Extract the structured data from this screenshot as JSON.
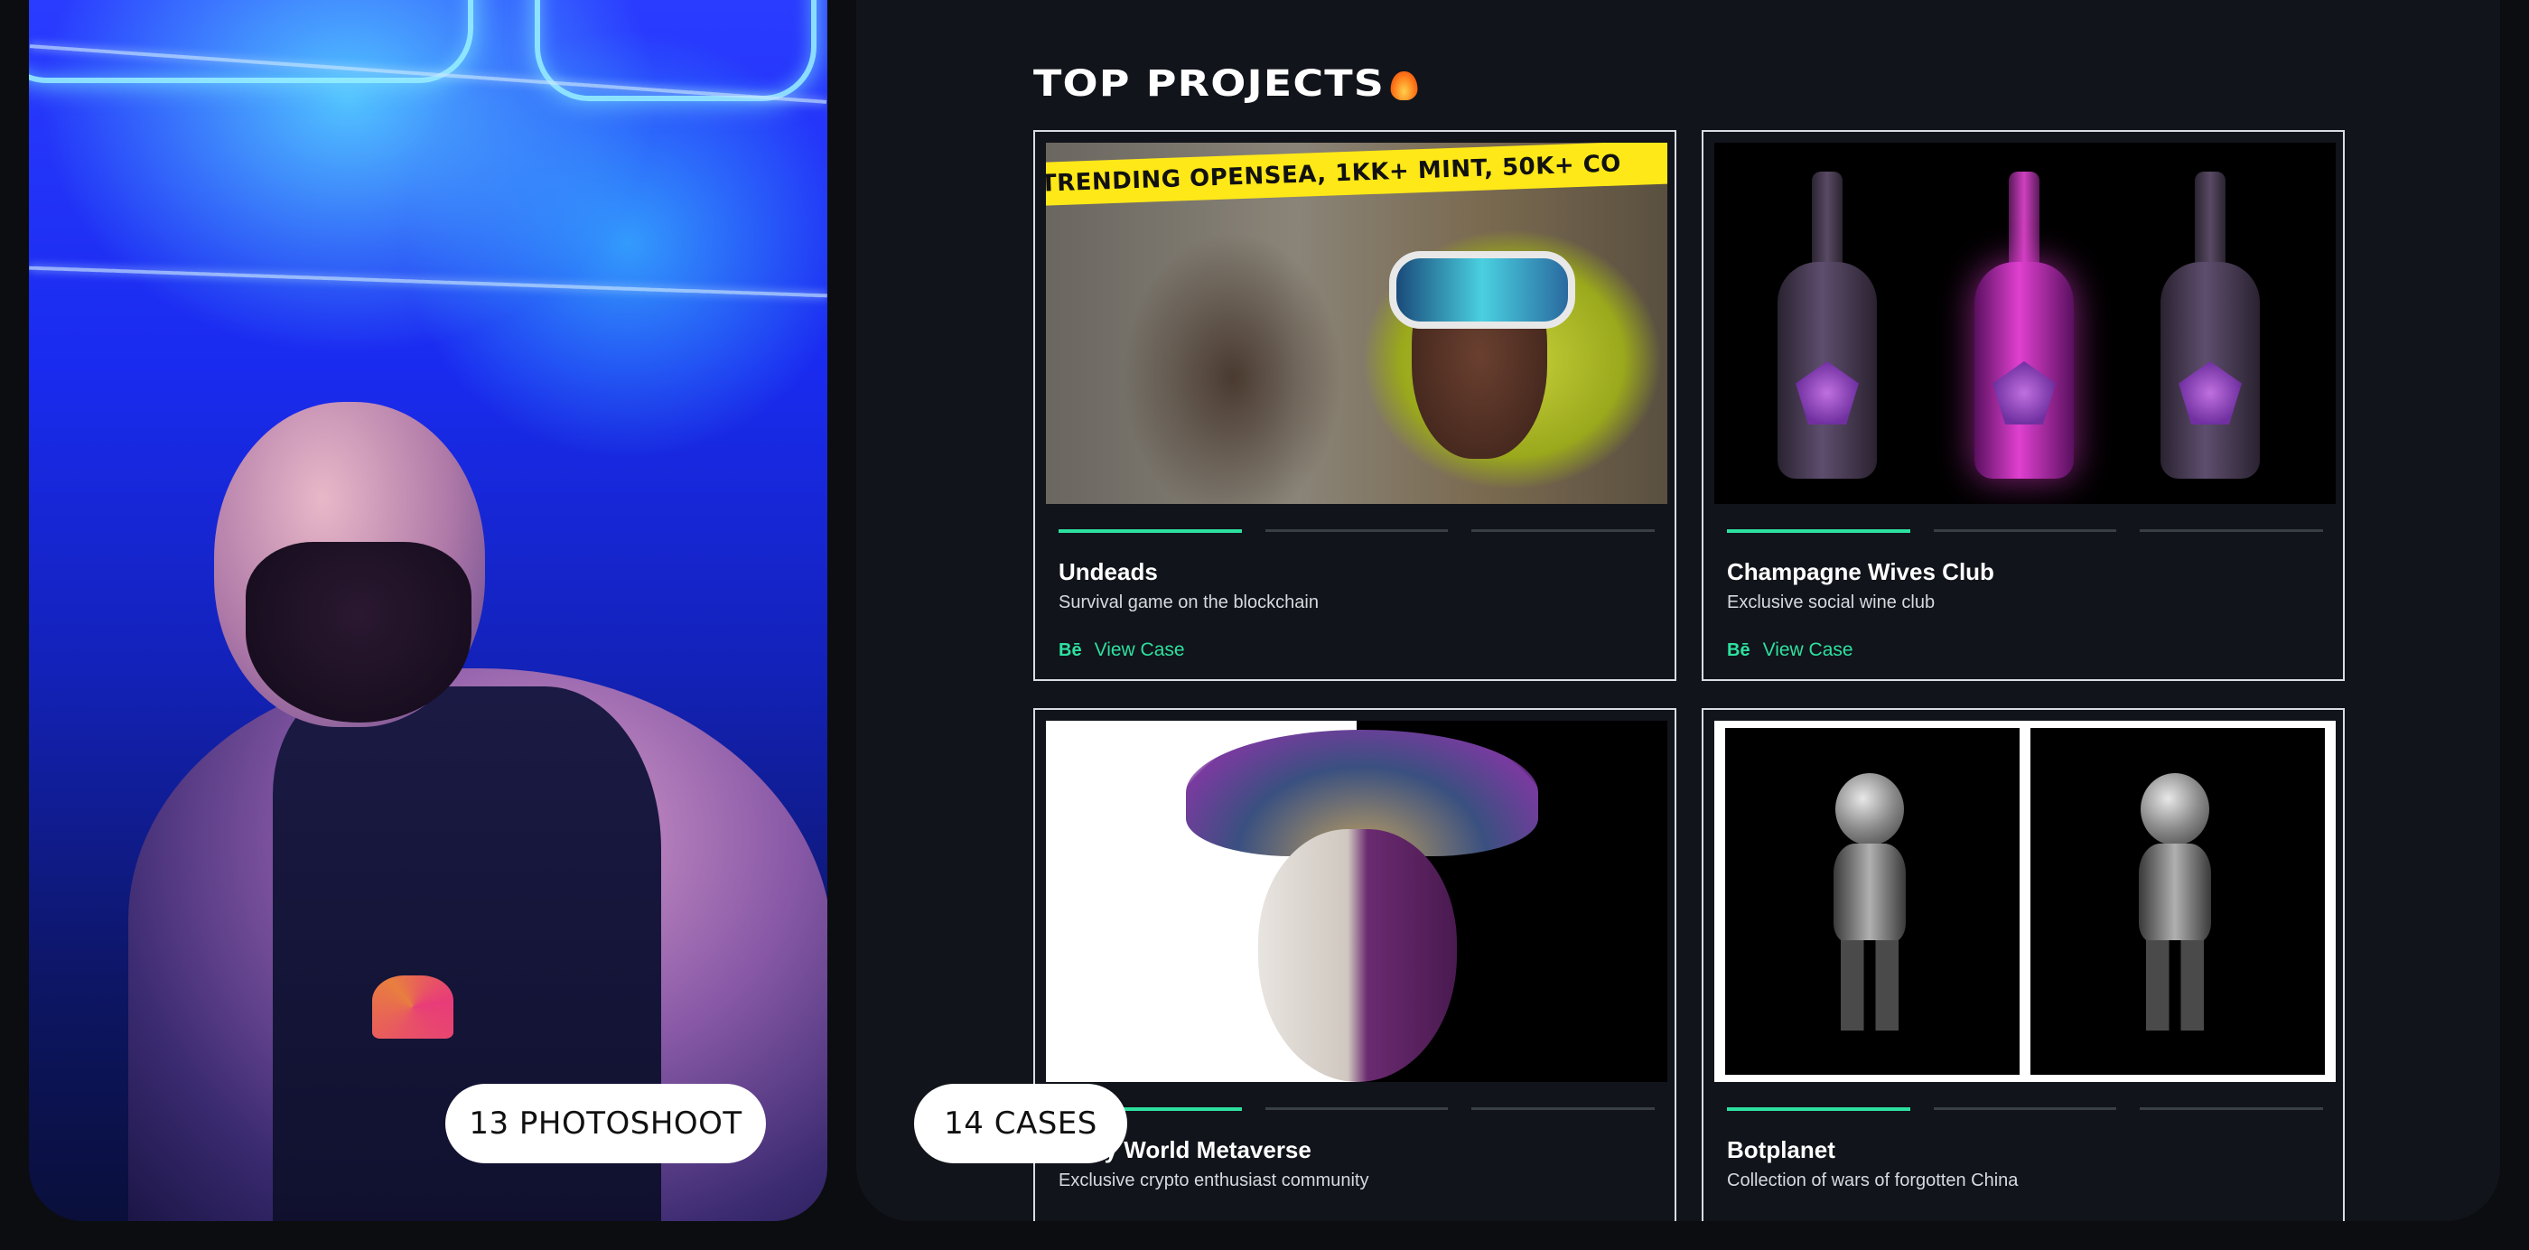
{
  "photo": {
    "badge_label": "13 PHOTOSHOOT"
  },
  "cases": {
    "badge_label": "14 CASES"
  },
  "section": {
    "title": "TOP PROJECTS"
  },
  "colors": {
    "accent": "#2ee0a0",
    "panel_bg": "#11141a",
    "page_bg": "#0b0d10"
  },
  "projects": [
    {
      "title": "Undeads",
      "subtitle": "Survival game on the blockchain",
      "link_icon": "Bē",
      "link_label": "View Case",
      "banner": "TRENDING OPENSEA, 1KK+ MINT, 50K+ CO"
    },
    {
      "title": "Champagne Wives Club",
      "subtitle": "Exclusive social wine club",
      "link_icon": "Bē",
      "link_label": "View Case"
    },
    {
      "title": "Party World Metaverse",
      "subtitle": "Exclusive crypto enthusiast community"
    },
    {
      "title": "Botplanet",
      "subtitle": "Collection of wars of forgotten China"
    }
  ]
}
